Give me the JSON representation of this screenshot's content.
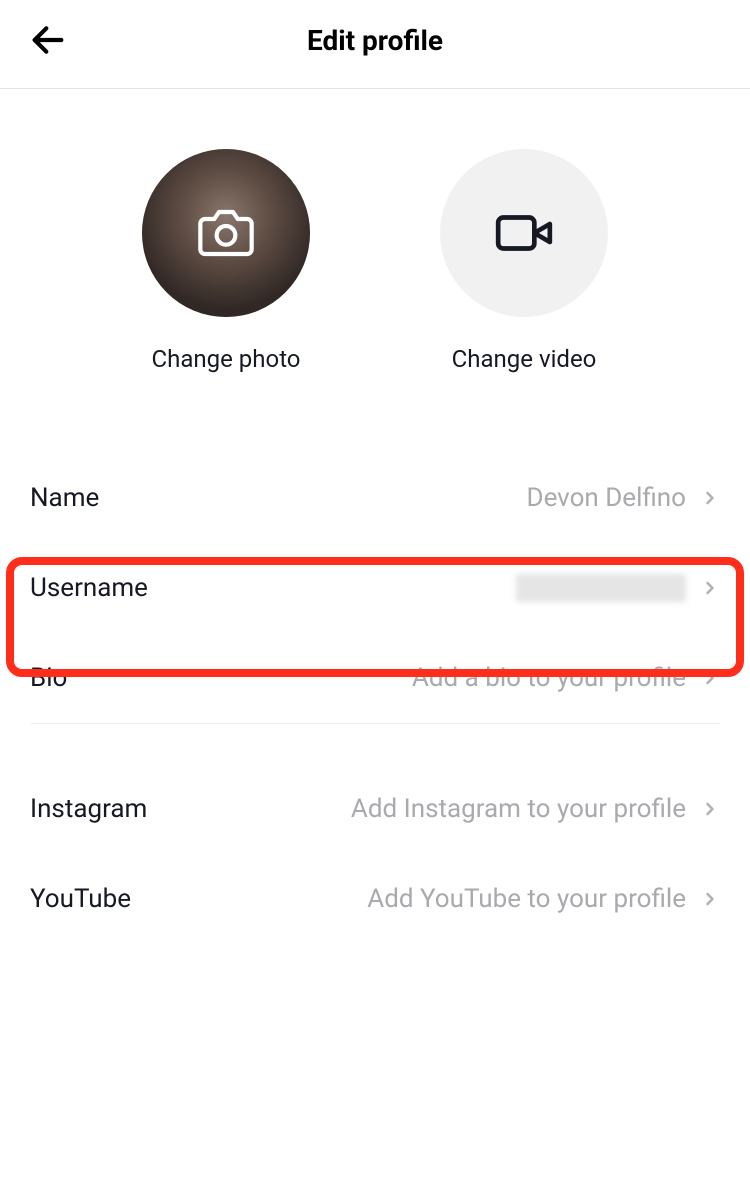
{
  "header": {
    "title": "Edit profile"
  },
  "media": {
    "photo_label": "Change photo",
    "video_label": "Change video"
  },
  "rows": {
    "name": {
      "label": "Name",
      "value": "Devon Delfino"
    },
    "username": {
      "label": "Username"
    },
    "bio": {
      "label": "Bio",
      "value": "Add a bio to your profile"
    },
    "instagram": {
      "label": "Instagram",
      "value": "Add Instagram to your profile"
    },
    "youtube": {
      "label": "YouTube",
      "value": "Add YouTube to your profile"
    }
  }
}
